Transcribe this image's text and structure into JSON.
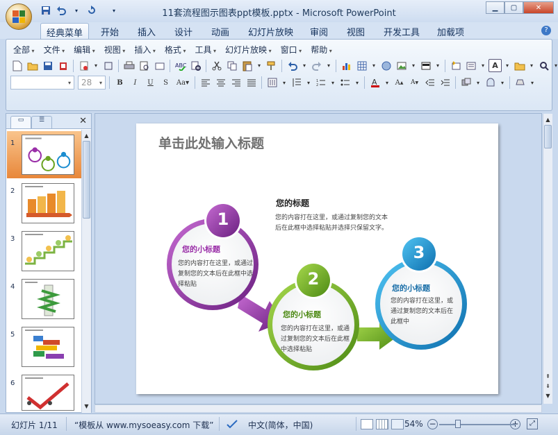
{
  "window": {
    "title": "11套流程图示图表ppt模板.pptx - Microsoft PowerPoint"
  },
  "ribbon_tabs": [
    "经典菜单",
    "开始",
    "插入",
    "设计",
    "动画",
    "幻灯片放映",
    "审阅",
    "视图",
    "开发工具",
    "加载项"
  ],
  "classic_menu": [
    "全部",
    "文件",
    "编辑",
    "视图",
    "插入",
    "格式",
    "工具",
    "幻灯片放映",
    "窗口",
    "帮助"
  ],
  "font_size_value": "28",
  "thumbnails": [
    "1",
    "2",
    "3",
    "4",
    "5",
    "6"
  ],
  "slide": {
    "title": "单击此处输入标题",
    "main_heading": "您的标题",
    "main_body": "您的内容打在这里，或通过复制您的文本后在此框中选择粘贴并选择只保留文字。",
    "steps": [
      {
        "number": "1",
        "heading": "您的小标题",
        "body": "您的内容打在这里，或通过复制您的文本后在此框中选择粘贴",
        "color": "#9a2fa8"
      },
      {
        "number": "2",
        "heading": "您的小标题",
        "body": "您的内容打在这里，或通过复制您的文本后在此框中选择粘贴",
        "color": "#6aa321"
      },
      {
        "number": "3",
        "heading": "您的小标题",
        "body": "您的内容打在这里，或通过复制您的文本后在此框中",
        "color": "#1b8dd0"
      }
    ]
  },
  "status": {
    "slide_counter": "幻灯片 1/11",
    "theme": "“模板从 www.mysoeasy.com 下载”",
    "language": "中文(简体，中国)",
    "zoom": "54%"
  }
}
